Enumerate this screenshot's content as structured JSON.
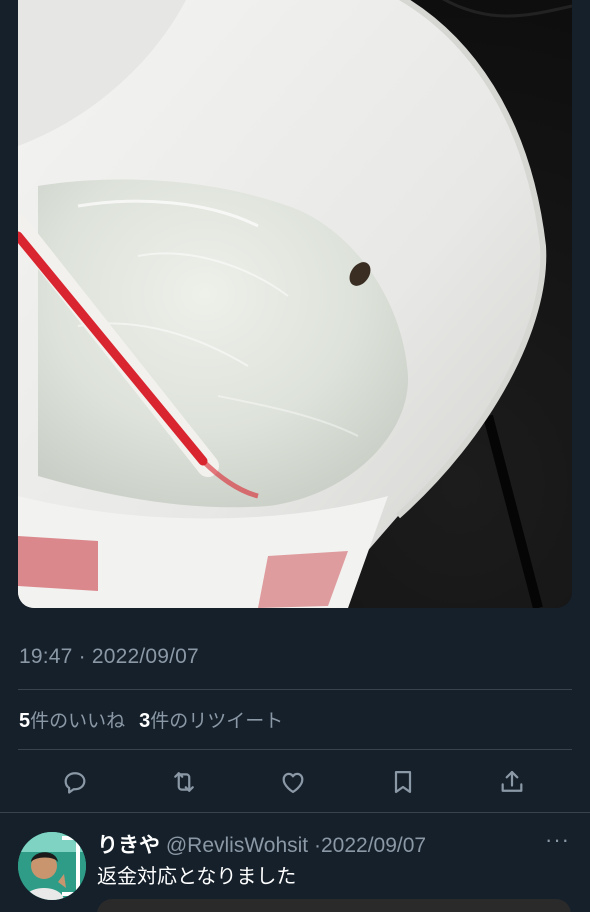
{
  "tweet": {
    "timestamp": "19:47 · 2022/09/07",
    "stats": {
      "likes_count": "5",
      "likes_label": "件のいいね",
      "retweets_count": "3",
      "retweets_label": "件のリツイート"
    },
    "actions": [
      "reply-icon",
      "retweet-icon",
      "like-icon",
      "bookmark-icon",
      "share-icon"
    ]
  },
  "reply": {
    "name": "りきや",
    "handle": "@RevlisWohsit",
    "separator": "·",
    "date": "2022/09/07",
    "more": "···",
    "text": "返金対応となりました"
  },
  "colors": {
    "background": "#15202b",
    "secondary_text": "#8b98a5",
    "divider": "#38444d"
  }
}
